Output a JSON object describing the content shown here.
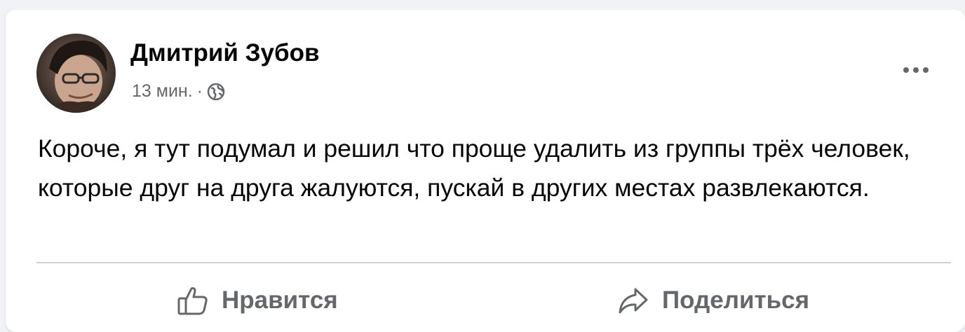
{
  "post": {
    "author": "Дмитрий Зубов",
    "time": "13 мин.",
    "separator": "·",
    "privacy_icon": "globe-icon",
    "more_icon": "more-dots-icon",
    "text": "Короче, я тут подумал и решил что проще удалить из группы трёх человек, которые друг на друга жалуются, пускай в других местах развлекаются."
  },
  "actions": {
    "like_label": "Нравится",
    "like_icon": "thumbs-up-icon",
    "share_label": "Поделиться",
    "share_icon": "share-arrow-icon"
  },
  "colors": {
    "text_primary": "#050505",
    "text_secondary": "#65676b",
    "divider": "#ced0d4",
    "background": "#f0f2f5"
  }
}
